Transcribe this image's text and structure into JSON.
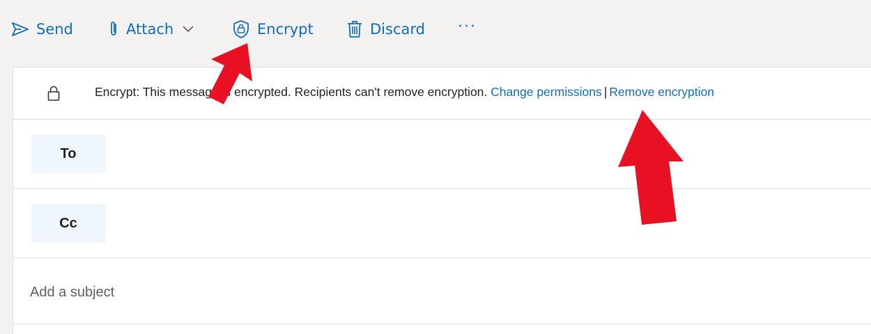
{
  "toolbar": {
    "send_label": "Send",
    "attach_label": "Attach",
    "encrypt_label": "Encrypt",
    "discard_label": "Discard",
    "more_label": "···"
  },
  "encryption": {
    "message": "Encrypt: This message is encrypted. Recipients can't remove encryption.",
    "change_permissions_label": "Change permissions",
    "separator": "|",
    "remove_encryption_label": "Remove encryption"
  },
  "recipients": {
    "to_label": "To",
    "cc_label": "Cc"
  },
  "subject": {
    "placeholder": "Add a subject",
    "value": ""
  },
  "colors": {
    "accent": "#0f6cbd",
    "annotation_arrow": "#e81123",
    "recipient_button_bg": "#eff6fc"
  },
  "icons": [
    "send-icon",
    "paperclip-icon",
    "chevron-down-icon",
    "shield-lock-icon",
    "trash-icon",
    "more-icon",
    "lock-icon"
  ]
}
